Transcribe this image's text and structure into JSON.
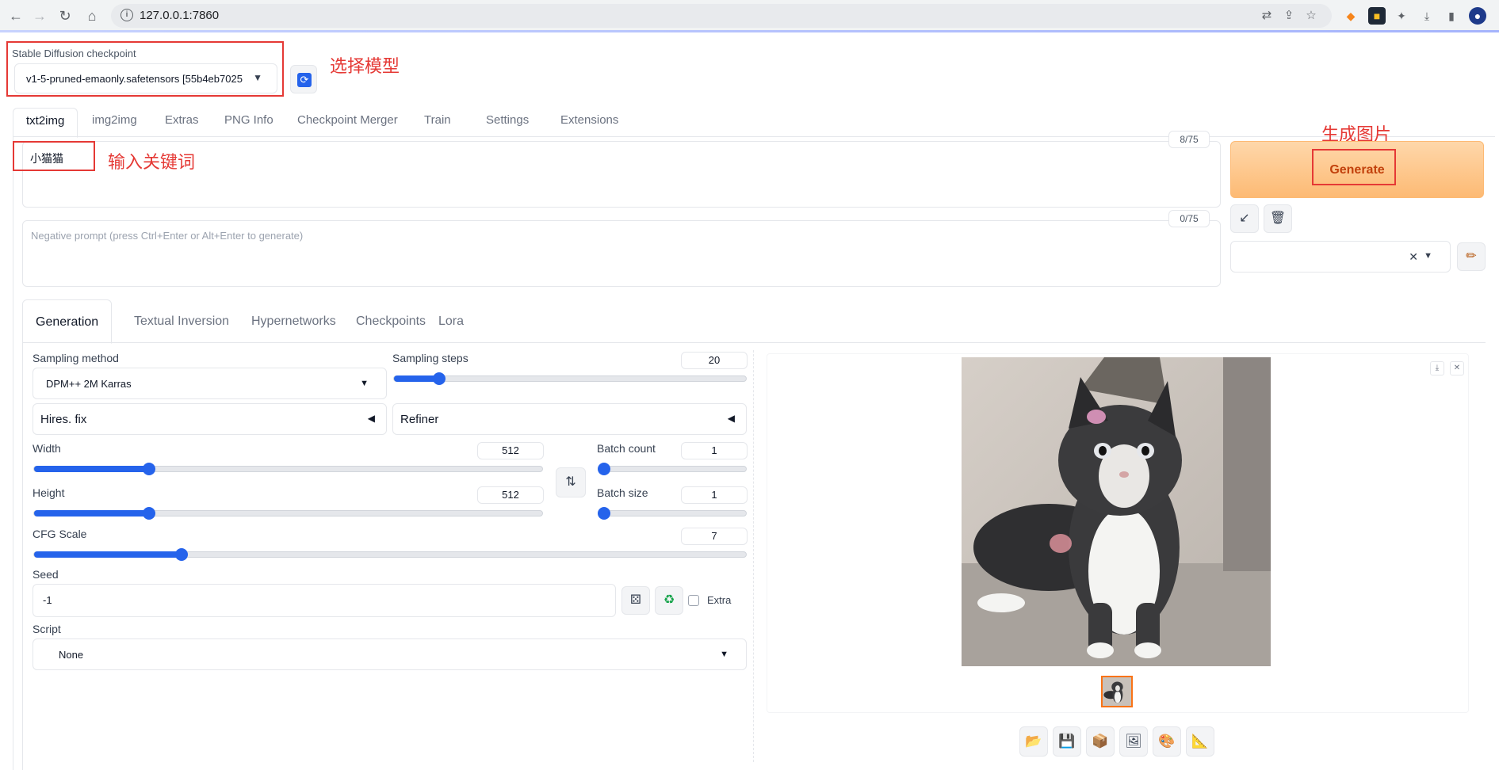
{
  "browser": {
    "url": "127.0.0.1:7860"
  },
  "checkpoint": {
    "label": "Stable Diffusion checkpoint",
    "value": "v1-5-pruned-emaonly.safetensors [55b4eb7025",
    "annotation": "选择模型"
  },
  "tabs": [
    {
      "label": "txt2img",
      "active": true
    },
    {
      "label": "img2img"
    },
    {
      "label": "Extras"
    },
    {
      "label": "PNG Info"
    },
    {
      "label": "Checkpoint Merger"
    },
    {
      "label": "Train"
    },
    {
      "label": "Settings"
    },
    {
      "label": "Extensions"
    }
  ],
  "prompt": {
    "value": "小猫猫",
    "token_count": "8/75",
    "annotation": "输入关键词"
  },
  "negative_prompt": {
    "placeholder": "Negative prompt (press Ctrl+Enter or Alt+Enter to generate)",
    "token_count": "0/75"
  },
  "generate": {
    "label": "Generate",
    "annotation": "生成图片"
  },
  "sub_tabs": [
    {
      "label": "Generation",
      "active": true
    },
    {
      "label": "Textual Inversion"
    },
    {
      "label": "Hypernetworks"
    },
    {
      "label": "Checkpoints"
    },
    {
      "label": "Lora"
    }
  ],
  "params": {
    "sampling_method": {
      "label": "Sampling method",
      "value": "DPM++ 2M Karras"
    },
    "sampling_steps": {
      "label": "Sampling steps",
      "value": "20",
      "min": 1,
      "max": 150,
      "current": 20
    },
    "hires_fix": "Hires. fix",
    "refiner": "Refiner",
    "width": {
      "label": "Width",
      "value": "512",
      "min": 64,
      "max": 2048,
      "current": 512
    },
    "height": {
      "label": "Height",
      "value": "512",
      "min": 64,
      "max": 2048,
      "current": 512
    },
    "batch_count": {
      "label": "Batch count",
      "value": "1",
      "min": 1,
      "max": 100,
      "current": 1
    },
    "batch_size": {
      "label": "Batch size",
      "value": "1",
      "min": 1,
      "max": 8,
      "current": 1
    },
    "cfg_scale": {
      "label": "CFG Scale",
      "value": "7",
      "min": 1,
      "max": 30,
      "current": 7
    },
    "seed": {
      "label": "Seed",
      "value": "-1",
      "extra_label": "Extra"
    },
    "script": {
      "label": "Script",
      "value": "None"
    }
  },
  "colors": {
    "accent": "#2563eb",
    "generate_bg": "#fdba74",
    "generate_text": "#c2410c",
    "annotation": "#e53935"
  }
}
